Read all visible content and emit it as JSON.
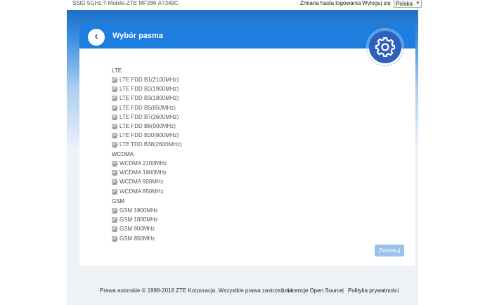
{
  "topbar": {
    "ssid": "SSID 5GHz:T-Mobile-ZTE MF286-A7349C",
    "change_password": "Zmiana hasła logowania",
    "logout": "Wyloguj się",
    "language": "Polska"
  },
  "page": {
    "title": "Wybór pasma",
    "apply": "Zastosuj"
  },
  "bands": {
    "lte": {
      "label": "LTE",
      "options": [
        {
          "label": "LTE FDD B1(2100MHz)",
          "checked": true
        },
        {
          "label": "LTE FDD B2(1900MHz)",
          "checked": true
        },
        {
          "label": "LTE FDD B3(1800MHz)",
          "checked": true
        },
        {
          "label": "LTE FDD B5(850MHz)",
          "checked": true
        },
        {
          "label": "LTE FDD B7(2600MHz)",
          "checked": true
        },
        {
          "label": "LTE FDD B8(900MHz)",
          "checked": true
        },
        {
          "label": "LTE FDD B20(800MHz)",
          "checked": true
        },
        {
          "label": "LTE TDD B38(2600MHz)",
          "checked": true
        }
      ]
    },
    "wcdma": {
      "label": "WCDMA",
      "options": [
        {
          "label": "WCDMA 2100MHz",
          "checked": true
        },
        {
          "label": "WCDMA 1900MHz",
          "checked": true
        },
        {
          "label": "WCDMA 900MHz",
          "checked": true
        },
        {
          "label": "WCDMA 850MHz",
          "checked": true
        }
      ]
    },
    "gsm": {
      "label": "GSM",
      "options": [
        {
          "label": "GSM 1900MHz",
          "checked": true
        },
        {
          "label": "GSM 1800MHz",
          "checked": true
        },
        {
          "label": "GSM 900MHz",
          "checked": true
        },
        {
          "label": "GSM 850MHz",
          "checked": true
        }
      ]
    }
  },
  "footer": {
    "copyright": "Prawa autorskie © 1998-2018 ZTE Korporacja. Wszystkie prawa zastrzeżone",
    "separator": "|",
    "licenses": "Licencje Open Source",
    "privacy": "Polityka prywatności"
  },
  "icons": {
    "back": "chevron-left-icon",
    "settings": "gear-icon",
    "checkbox": "check-icon",
    "dropdown": "chevron-down-icon"
  },
  "colors": {
    "header": "#1e7ee0",
    "gear_bg": "#2f5fbd",
    "apply_disabled": "#9bc2eb"
  }
}
